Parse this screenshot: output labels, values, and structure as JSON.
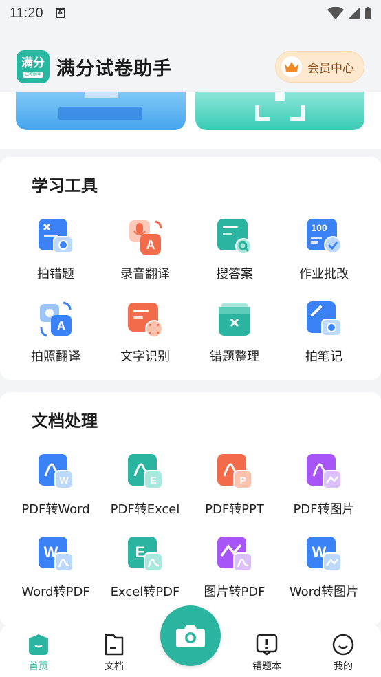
{
  "status_bar": {
    "time": "11:20",
    "notification_icon": "A"
  },
  "header": {
    "logo_text": "满分",
    "logo_sub": "试卷助手",
    "app_title": "满分试卷助手",
    "vip_label": "会员中心"
  },
  "study_tools": {
    "title": "学习工具",
    "items": [
      {
        "label": "拍错题",
        "icon": "photo-mistake-icon",
        "color": "#3b82f6"
      },
      {
        "label": "录音翻译",
        "icon": "record-translate-icon",
        "color": "#f26b4a"
      },
      {
        "label": "搜答案",
        "icon": "search-answer-icon",
        "color": "#2bb5a0"
      },
      {
        "label": "作业批改",
        "icon": "homework-check-icon",
        "color": "#3b82f6"
      },
      {
        "label": "拍照翻译",
        "icon": "photo-translate-icon",
        "color": "#3b82f6"
      },
      {
        "label": "文字识别",
        "icon": "text-recognition-icon",
        "color": "#f26b4a"
      },
      {
        "label": "错题整理",
        "icon": "mistake-organize-icon",
        "color": "#2bb5a0"
      },
      {
        "label": "拍笔记",
        "icon": "photo-note-icon",
        "color": "#3b82f6"
      }
    ]
  },
  "doc_tools": {
    "title": "文档处理",
    "items": [
      {
        "label": "PDF转Word",
        "icon": "pdf-to-word-icon",
        "color": "#3b82f6",
        "badge": "W"
      },
      {
        "label": "PDF转Excel",
        "icon": "pdf-to-excel-icon",
        "color": "#2bb5a0",
        "badge": "E"
      },
      {
        "label": "PDF转PPT",
        "icon": "pdf-to-ppt-icon",
        "color": "#f26b4a",
        "badge": "P"
      },
      {
        "label": "PDF转图片",
        "icon": "pdf-to-image-icon",
        "color": "#a855f7",
        "badge": "img"
      },
      {
        "label": "Word转PDF",
        "icon": "word-to-pdf-icon",
        "color": "#3b82f6",
        "badge": "W"
      },
      {
        "label": "Excel转PDF",
        "icon": "excel-to-pdf-icon",
        "color": "#2bb5a0",
        "badge": "E"
      },
      {
        "label": "图片转PDF",
        "icon": "image-to-pdf-icon",
        "color": "#a855f7",
        "badge": "img"
      },
      {
        "label": "Word转图片",
        "icon": "word-to-image-icon",
        "color": "#3b82f6",
        "badge": "W"
      }
    ]
  },
  "bottom_nav": {
    "items": [
      {
        "label": "首页",
        "icon": "home-icon",
        "active": true
      },
      {
        "label": "文档",
        "icon": "document-icon",
        "active": false
      },
      {
        "label": "错题本",
        "icon": "mistake-book-icon",
        "active": false
      },
      {
        "label": "我的",
        "icon": "profile-icon",
        "active": false
      }
    ],
    "camera_icon": "camera-icon"
  },
  "colors": {
    "accent": "#2bb5a0",
    "blue": "#3b82f6",
    "orange": "#f26b4a",
    "purple": "#a855f7",
    "vip_text": "#8b4a16"
  }
}
